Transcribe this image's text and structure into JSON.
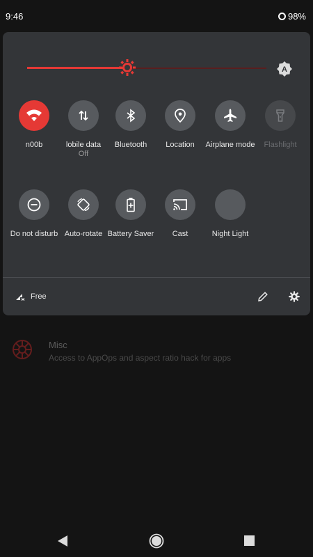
{
  "status_bar": {
    "time": "9:46",
    "battery": "98%"
  },
  "brightness": {
    "level": 0.42,
    "auto_label": "A"
  },
  "tiles": [
    {
      "label": "n00b",
      "sub": "",
      "icon": "wifi-icon",
      "state": "active"
    },
    {
      "label": "lobile data",
      "sub": "Off",
      "icon": "mobile-data-icon",
      "state": "inactive"
    },
    {
      "label": "Bluetooth",
      "sub": "",
      "icon": "bluetooth-icon",
      "state": "inactive"
    },
    {
      "label": "Location",
      "sub": "",
      "icon": "location-icon",
      "state": "inactive"
    },
    {
      "label": "Airplane mode",
      "sub": "",
      "icon": "airplane-icon",
      "state": "inactive"
    },
    {
      "label": "Flashlight",
      "sub": "",
      "icon": "flashlight-icon",
      "state": "disabled"
    },
    {
      "label": "Do not disturb",
      "sub": "",
      "icon": "do-not-disturb-icon",
      "state": "inactive"
    },
    {
      "label": "Auto-rotate",
      "sub": "",
      "icon": "auto-rotate-icon",
      "state": "inactive"
    },
    {
      "label": "Battery Saver",
      "sub": "",
      "icon": "battery-saver-icon",
      "state": "inactive"
    },
    {
      "label": "Cast",
      "sub": "",
      "icon": "cast-icon",
      "state": "inactive"
    },
    {
      "label": "Night Light",
      "sub": "",
      "icon": "night-light-icon",
      "state": "inactive"
    }
  ],
  "footer": {
    "carrier": "Free"
  },
  "background_item": {
    "title": "Misc",
    "subtitle": "Access to AppOps and aspect ratio hack for apps"
  },
  "colors": {
    "accent": "#e53935",
    "panel": "#333538",
    "tile": "#575a5e",
    "background": "#141414"
  }
}
